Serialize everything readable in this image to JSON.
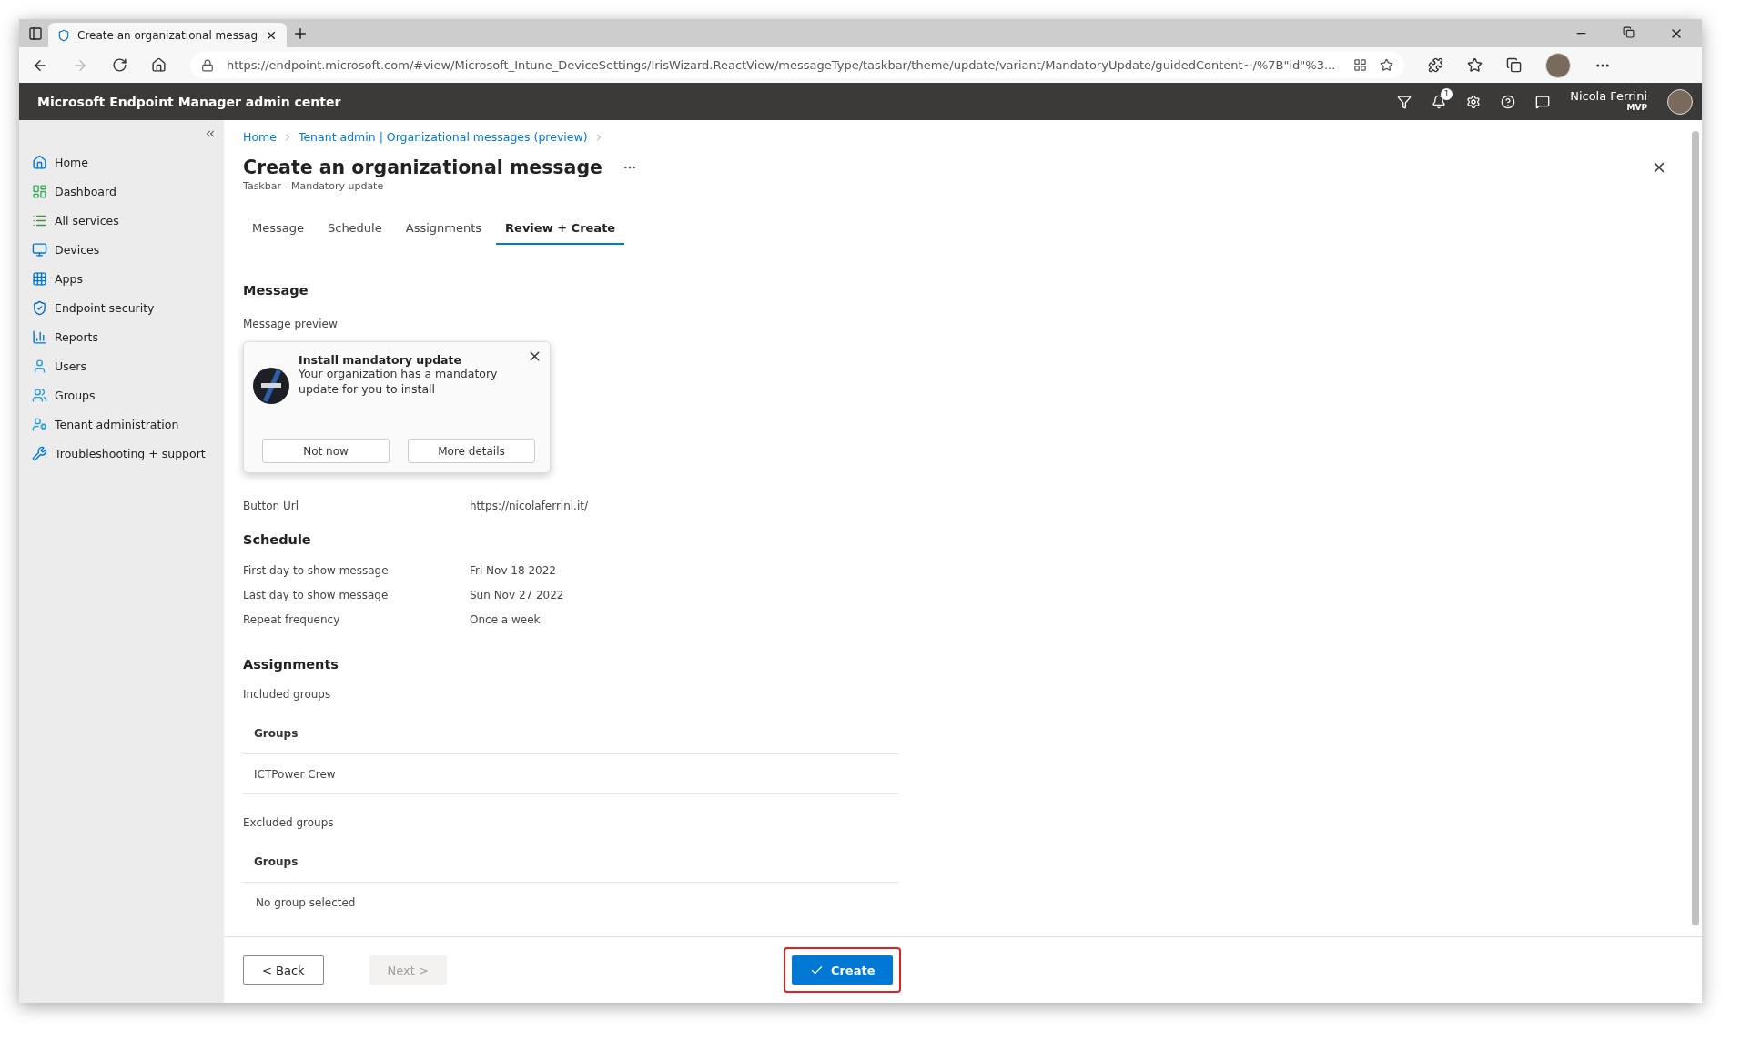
{
  "browser": {
    "tab_title": "Create an organizational messag",
    "url": "https://endpoint.microsoft.com/#view/Microsoft_Intune_DeviceSettings/IrisWizard.ReactView/messageType/taskbar/theme/update/variant/MandatoryUpdate/guidedContent~/%7B\"id\"%3..."
  },
  "portal": {
    "title": "Microsoft Endpoint Manager admin center",
    "notification_count": "1",
    "user_name": "Nicola Ferrini",
    "user_badge": "MVP"
  },
  "sidebar": {
    "items": [
      {
        "label": "Home",
        "kind": "home"
      },
      {
        "label": "Dashboard",
        "kind": "dashboard"
      },
      {
        "label": "All services",
        "kind": "services"
      },
      {
        "label": "Devices",
        "kind": "devices"
      },
      {
        "label": "Apps",
        "kind": "apps"
      },
      {
        "label": "Endpoint security",
        "kind": "security"
      },
      {
        "label": "Reports",
        "kind": "reports"
      },
      {
        "label": "Users",
        "kind": "users"
      },
      {
        "label": "Groups",
        "kind": "groups"
      },
      {
        "label": "Tenant administration",
        "kind": "tenant"
      },
      {
        "label": "Troubleshooting + support",
        "kind": "tools"
      }
    ]
  },
  "breadcrumb": [
    "Home",
    "Tenant admin | Organizational messages (preview)"
  ],
  "page": {
    "title": "Create an organizational message",
    "subtitle": "Taskbar - Mandatory update"
  },
  "tabs": [
    {
      "label": "Message",
      "selected": false
    },
    {
      "label": "Schedule",
      "selected": false
    },
    {
      "label": "Assignments",
      "selected": false
    },
    {
      "label": "Review + Create",
      "selected": true
    }
  ],
  "message_section": {
    "heading": "Message",
    "preview_label": "Message preview",
    "preview": {
      "title": "Install mandatory update",
      "body": "Your organization has a mandatory update for you to install",
      "buttons": [
        "Not now",
        "More details"
      ]
    },
    "fields": [
      {
        "label": "Button Url",
        "value": "https://nicolaferrini.it/"
      }
    ]
  },
  "schedule": {
    "heading": "Schedule",
    "fields": [
      {
        "label": "First day to show message",
        "value": "Fri Nov 18 2022"
      },
      {
        "label": "Last day to show message",
        "value": "Sun Nov 27 2022"
      },
      {
        "label": "Repeat frequency",
        "value": "Once a week"
      }
    ]
  },
  "assignments": {
    "heading": "Assignments",
    "tables": [
      {
        "label": "Included groups",
        "column": "Groups",
        "rows": [
          "ICTPower Crew"
        ]
      },
      {
        "label": "Excluded groups",
        "column": "Groups",
        "rows": [
          "No group selected"
        ]
      }
    ]
  },
  "footer": {
    "buttons": [
      {
        "label": "< Back",
        "kind": "secondary"
      },
      {
        "label": "Next >",
        "kind": "disabled"
      },
      {
        "label": "Create",
        "kind": "primary",
        "highlighted": true
      }
    ]
  }
}
